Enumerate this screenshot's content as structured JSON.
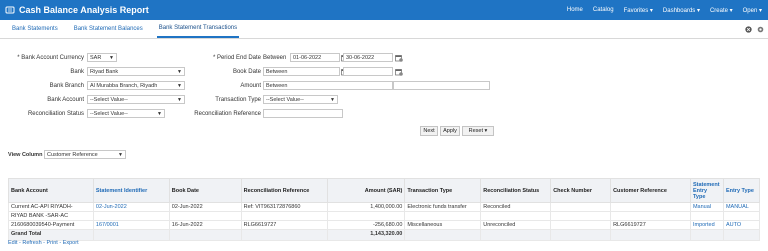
{
  "header": {
    "title": "Cash Balance Analysis Report",
    "nav": [
      "Home",
      "Catalog",
      "Favorites ▾",
      "Dashboards ▾",
      "Create ▾",
      "Open ▾"
    ]
  },
  "tabs": [
    "Bank Statements",
    "Bank Statement Balances",
    "Bank Statement Transactions"
  ],
  "filters": {
    "currency_label": "* Bank Account Currency",
    "currency_value": "SAR",
    "bank_label": "Bank",
    "bank_value": "Riyad Bank",
    "branch_label": "Bank Branch",
    "branch_value": "Al Murabba Branch, Riyadh",
    "account_label": "Bank Account",
    "account_value": "--Select Value--",
    "recon_status_label": "Reconciliation Status",
    "recon_status_value": "--Select Value--",
    "period_label": "* Period End Date",
    "period_op": "Between",
    "period_from": "01-06-2022",
    "period_to": "30-06-2022",
    "book_label": "Book Date",
    "book_op": "Between",
    "amount_label": "Amount",
    "amount_op": "Between",
    "txn_type_label": "Transaction Type",
    "txn_type_value": "--Select Value--",
    "recon_ref_label": "Reconciliation Reference"
  },
  "buttons": {
    "next": "Next",
    "apply": "Apply",
    "reset": "Reset ▾"
  },
  "view": {
    "label": "View Column",
    "value": "Customer Reference"
  },
  "table": {
    "headers": [
      "Bank Account",
      "Statement Identifier",
      "Book Date",
      "Reconciliation Reference",
      "Amount (SAR)",
      "Transaction Type",
      "Reconciliation Status",
      "Check Number",
      "Customer Reference",
      "Statement Entry Type",
      "Entry Type"
    ],
    "rows": [
      {
        "c0": "Current AC-API RIYADH-",
        "c1": "02-Jun-2022",
        "c2": "02-Jun-2022",
        "c3": "Ref: VIT963172876860",
        "c4": "1,400,000.00",
        "c5": "Electronic funds transfer",
        "c6": "Reconciled",
        "c7": "",
        "c8": "",
        "c9": "Manual",
        "c10": "MANUAL"
      },
      {
        "c0": "RIYAD BANK -SAR-AC",
        "c1": "",
        "c2": "",
        "c3": "",
        "c4": "",
        "c5": "",
        "c6": "",
        "c7": "",
        "c8": "",
        "c9": "",
        "c10": ""
      },
      {
        "c0": "2160680039540-Payment",
        "c1": "167/0001",
        "c2": "16-Jun-2022",
        "c3": "RLG6619727",
        "c4": "-256,680.00",
        "c5": "Miscellaneous",
        "c6": "Unreconciled",
        "c7": "",
        "c8": "RLG6619727",
        "c9": "Imported",
        "c10": "AUTO"
      }
    ],
    "total_label": "Grand Total",
    "total_value": "1,143,320.00"
  },
  "footer": "Edit - Refresh - Print - Export"
}
